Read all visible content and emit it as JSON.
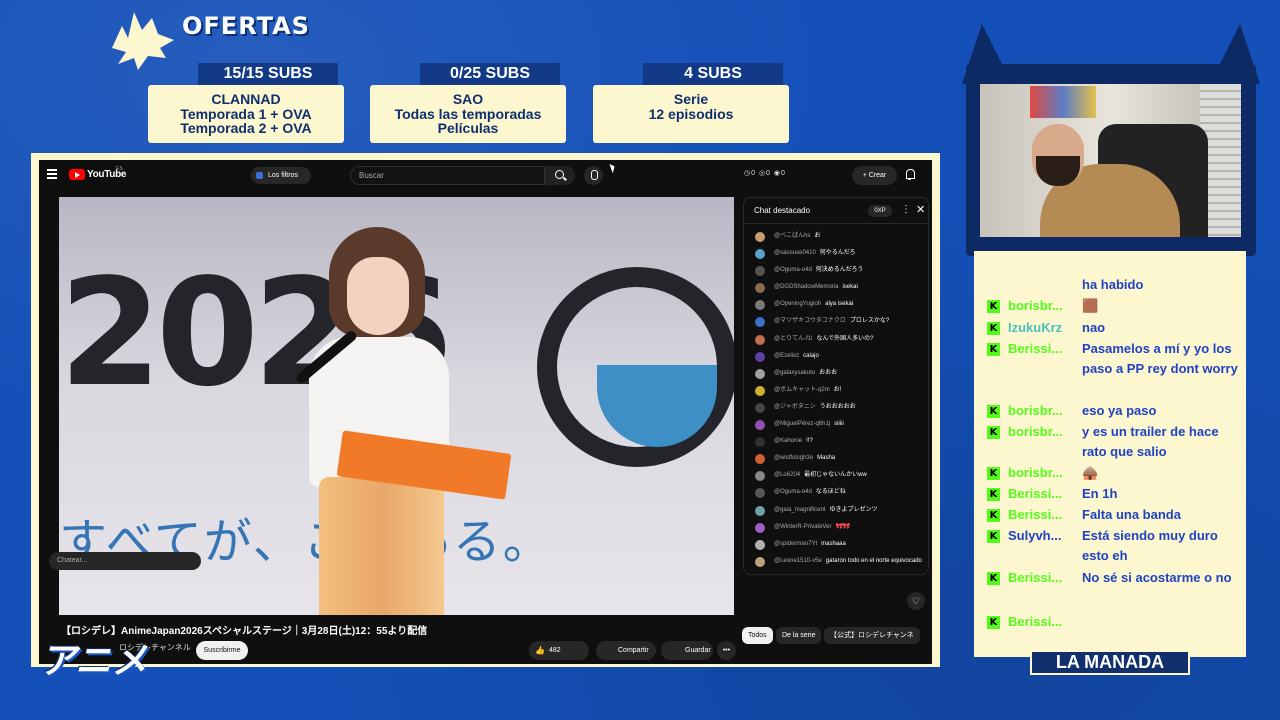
{
  "header": {
    "title": "OFERTAS"
  },
  "offers": [
    {
      "subs": "15/15 SUBS",
      "lines": [
        "CLANNAD",
        "Temporada 1 + OVA",
        "Temporada 2 + OVA"
      ]
    },
    {
      "subs": "0/25 SUBS",
      "lines": [
        "SAO",
        "Todas las temporadas",
        "Películas"
      ]
    },
    {
      "subs": "4 SUBS",
      "lines": [
        "Serie",
        "12 episodios"
      ]
    }
  ],
  "youtube": {
    "logo": "YouTube",
    "logo_sup": "ES",
    "filters_label": "Los filtros",
    "search_placeholder": "Buscar",
    "ext_icons": "◷0 ◎0 ◉0",
    "create_label": "+ Crear",
    "video": {
      "overlay_number": "2026",
      "overlay_caption": "すべてが、こ　ある。",
      "title": "【ロシデレ】AnimeJapan2026スペシャルステージ｜3月28日(土)12：55より配信",
      "channel": "ロシデレチャンネル",
      "subscribe_label": "Suscribirme",
      "likes": "482",
      "share_label": "Compartir",
      "save_label": "Guardar",
      "more_label": "•••"
    },
    "chat": {
      "header": "Chat destacado",
      "xp": "0XP",
      "input_placeholder": "Chatear...",
      "messages": [
        {
          "author": "@べこぱんhs",
          "text": "お",
          "avatar_color": "#c8a070"
        },
        {
          "author": "@saususe0410",
          "text": "何やるんだろ",
          "avatar_color": "#5aa0d0"
        },
        {
          "author": "@Oguma-o4d",
          "text": "何決めるんだろう",
          "avatar_color": "#555555"
        },
        {
          "author": "@DGDShadowMemoria",
          "text": "isekai",
          "avatar_color": "#8a6a4a"
        },
        {
          "author": "@OpeningYugioh",
          "text": "alya isekai",
          "avatar_color": "#7a7a7a"
        },
        {
          "author": "@マツザキコウタコナクロ",
          "text": "プロレスかな?",
          "avatar_color": "#3a70c8"
        },
        {
          "author": "@とりてん-f1l",
          "text": "なんで外国人多いの?",
          "avatar_color": "#c07050"
        },
        {
          "author": "@Ezelixz",
          "text": "calajo",
          "avatar_color": "#6040a0"
        },
        {
          "author": "@galaxysakuto",
          "text": "おおお",
          "avatar_color": "#a0a0a0"
        },
        {
          "author": "@ボムキャット-q2m",
          "text": "お!",
          "avatar_color": "#d0b030"
        },
        {
          "author": "@ジャボタニシ",
          "text": "うおおおおお",
          "avatar_color": "#444444"
        },
        {
          "author": "@MiguelPérez-q6h1j",
          "text": "siiiii",
          "avatar_color": "#9050b0"
        },
        {
          "author": "@Kahonie",
          "text": "!!?",
          "avatar_color": "#303030"
        },
        {
          "author": "@wistfulsgh3e",
          "text": "Masha",
          "avatar_color": "#d06030"
        },
        {
          "author": "@Lo6204",
          "text": "最初じゃないんかいww",
          "avatar_color": "#888888"
        },
        {
          "author": "@Oguma-o4d",
          "text": "なるほどね",
          "avatar_color": "#555555"
        },
        {
          "author": "@gaia_magnificent",
          "text": "ゆきよプレゼンツ",
          "avatar_color": "#70a0a0"
        },
        {
          "author": "@WinterR-PrivateVer",
          "text": "🎀🎀",
          "avatar_color": "#a060c0"
        },
        {
          "author": "@spiderman7Yt",
          "text": "mashaaa",
          "avatar_color": "#b0b0b0"
        },
        {
          "author": "@Leone1510-x5e",
          "text": "gataron todo en el norte equivocado",
          "avatar_color": "#c0a080"
        }
      ]
    },
    "tabs": [
      "Todos",
      "De la serie",
      "【公式】ロシデレチャンネ"
    ]
  },
  "anime_logo": "アニメ",
  "right_chat": {
    "messages": [
      {
        "user": "",
        "text": "ha habido",
        "user_color": "#1f42c5"
      },
      {
        "user": "borisbr...",
        "text": "🟫",
        "user_color": "#53fc18"
      },
      {
        "user": "IzukuKrz",
        "text": "nao",
        "user_color": "#4bc0c0"
      },
      {
        "user": "Berissi...",
        "text": "Pasamelos a mí y yo los paso a PP rey dont worry",
        "user_color": "#53fc18"
      },
      {
        "user": "borisbr...",
        "text": "eso ya paso",
        "user_color": "#53fc18"
      },
      {
        "user": "borisbr...",
        "text": "y es un trailer de hace rato que salio",
        "user_color": "#53fc18"
      },
      {
        "user": "borisbr...",
        "text": "🛖",
        "user_color": "#53fc18"
      },
      {
        "user": "Berissi...",
        "text": "En 1h",
        "user_color": "#53fc18"
      },
      {
        "user": "Berissi...",
        "text": "Falta una banda",
        "user_color": "#53fc18"
      },
      {
        "user": "Sulyvh...",
        "text": "Está siendo muy duro esto eh",
        "user_color": "#1f42c5"
      },
      {
        "user": "Berissi...",
        "text": "No sé si acostarme o no",
        "user_color": "#53fc18"
      },
      {
        "user": "Berissi...",
        "text": "",
        "user_color": "#53fc18"
      }
    ],
    "footer": "LA MANADA"
  }
}
